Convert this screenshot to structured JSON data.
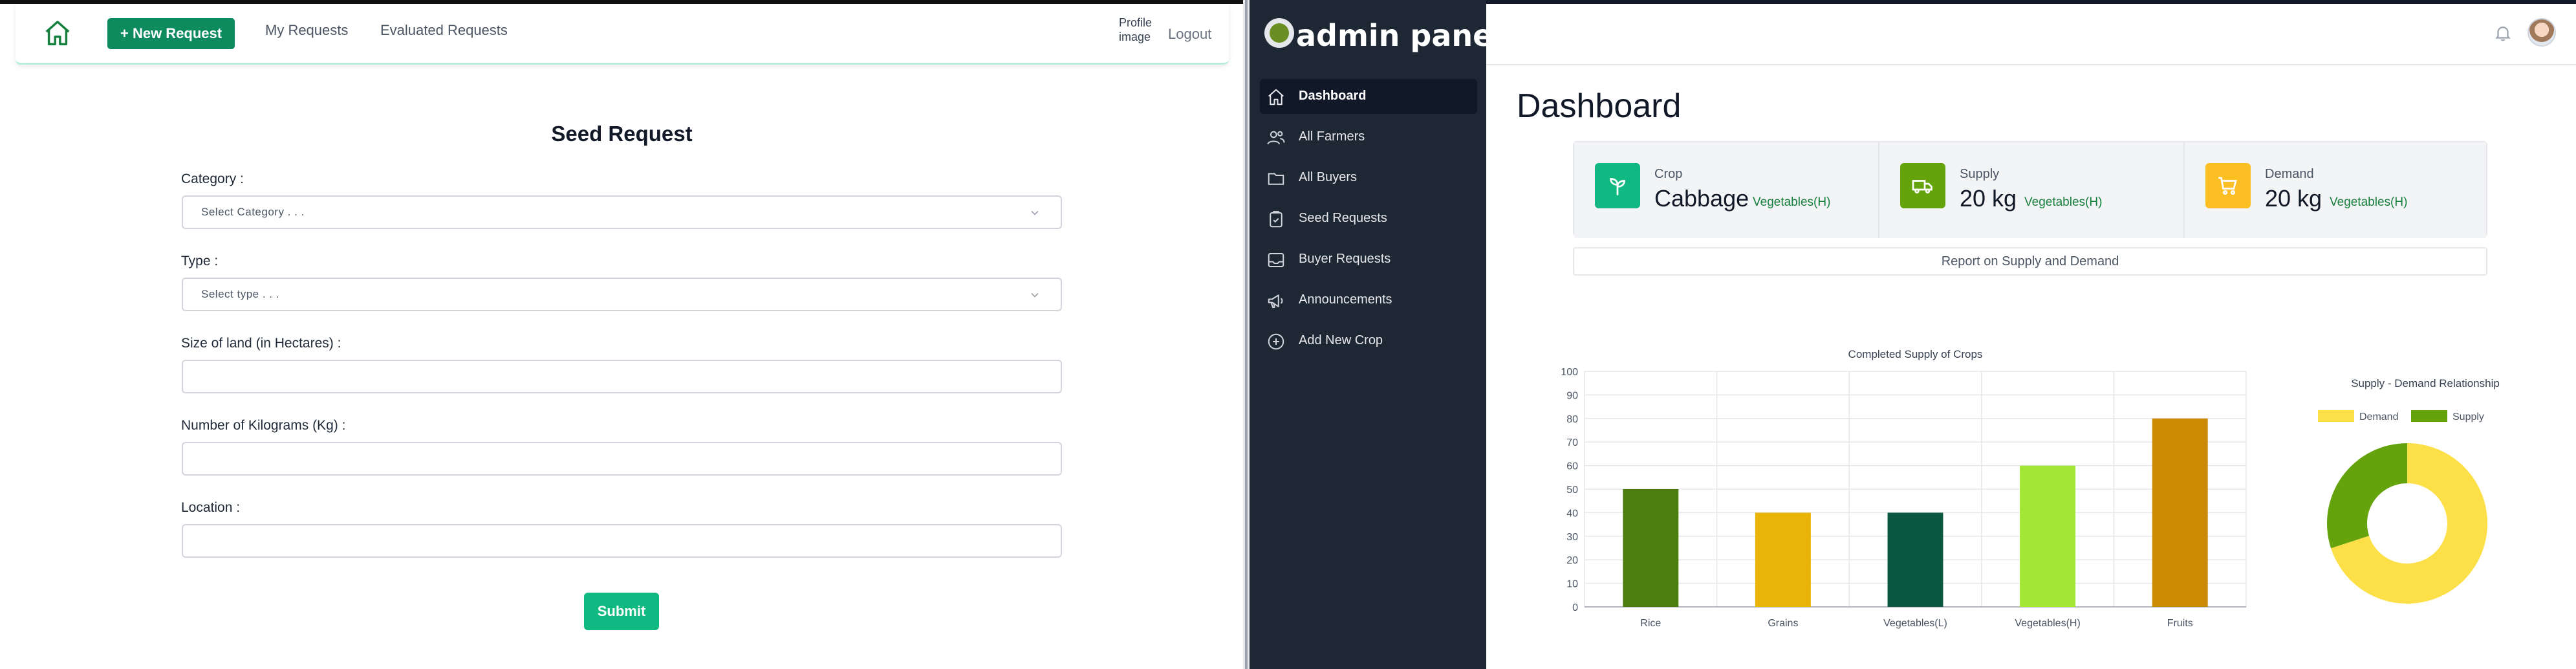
{
  "left": {
    "nav": {
      "new_request": "+ New Request",
      "my_requests": "My Requests",
      "evaluated_requests": "Evaluated Requests",
      "profile_image_alt": "Profile image",
      "logout": "Logout"
    },
    "form": {
      "title": "Seed Request",
      "category_label": "Category :",
      "category_placeholder": "Select Category . . .",
      "type_label": "Type :",
      "type_placeholder": "Select type . . .",
      "land_label": "Size of land (in Hectares) :",
      "kg_label": "Number of Kilograms (Kg) :",
      "location_label": "Location :",
      "submit": "Submit"
    }
  },
  "right": {
    "brand": "admin panel",
    "sidebar": [
      {
        "label": "Dashboard",
        "icon": "home-icon",
        "active": true
      },
      {
        "label": "All Farmers",
        "icon": "users-icon",
        "active": false
      },
      {
        "label": "All Buyers",
        "icon": "folder-icon",
        "active": false
      },
      {
        "label": "Seed Requests",
        "icon": "clipboard-icon",
        "active": false
      },
      {
        "label": "Buyer Requests",
        "icon": "inbox-icon",
        "active": false
      },
      {
        "label": "Announcements",
        "icon": "megaphone-icon",
        "active": false
      },
      {
        "label": "Add New Crop",
        "icon": "plus-circle-icon",
        "active": false
      }
    ],
    "dashboard_title": "Dashboard",
    "cards": [
      {
        "label": "Crop",
        "value": "Cabbage",
        "tag": "Vegetables(H)",
        "color": "#10b981",
        "icon": "sprout-icon"
      },
      {
        "label": "Supply",
        "value": "20 kg",
        "tag": "Vegetables(H)",
        "color": "#65a30d",
        "icon": "truck-icon"
      },
      {
        "label": "Demand",
        "value": "20 kg",
        "tag": "Vegetables(H)",
        "color": "#fbbf24",
        "icon": "cart-icon"
      }
    ],
    "report_label": "Report on Supply and Demand"
  },
  "chart_data": [
    {
      "type": "bar",
      "title": "Completed Supply of Crops",
      "categories": [
        "Rice",
        "Grains",
        "Vegetables(L)",
        "Vegetables(H)",
        "Fruits"
      ],
      "values": [
        50,
        40,
        40,
        60,
        80
      ],
      "colors": [
        "#4d7c0f",
        "#eab308",
        "#0b5740",
        "#a3e635",
        "#ca8a04"
      ],
      "ylim": [
        0,
        100
      ],
      "yticks": [
        0,
        10,
        20,
        30,
        40,
        50,
        60,
        70,
        80,
        90,
        100
      ],
      "grid": true
    },
    {
      "type": "pie",
      "title": "Supply - Demand Relationship",
      "labels": [
        "Demand",
        "Supply"
      ],
      "values": [
        70,
        30
      ],
      "colors": [
        "#fde047",
        "#65a30d"
      ],
      "donut": true,
      "legend": "top"
    }
  ]
}
